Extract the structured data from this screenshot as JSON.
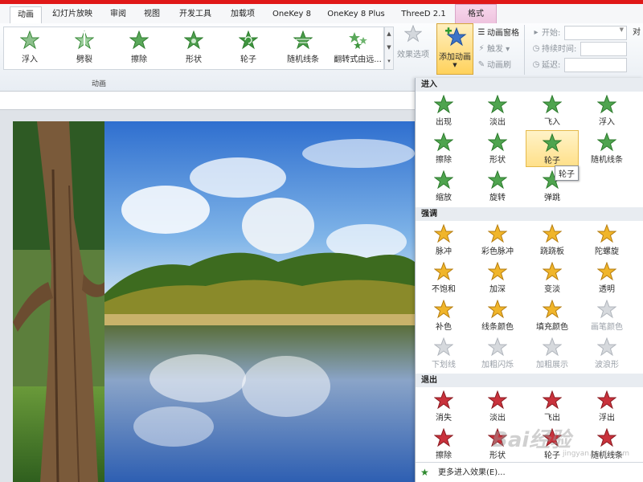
{
  "tabs": [
    "动画",
    "幻灯片放映",
    "审阅",
    "视图",
    "开发工具",
    "加载项",
    "OneKey 8",
    "OneKey 8 Plus",
    "ThreeD 2.1",
    "格式"
  ],
  "ribbon": {
    "gallery": [
      "浮入",
      "劈裂",
      "擦除",
      "形状",
      "轮子",
      "随机线条",
      "翻转式由远..."
    ],
    "group_label": "动画",
    "effect_options": "效果选项",
    "add_animation": "添加动画",
    "animation_pane": "动画窗格",
    "trigger": "触发",
    "animation_painter": "动画刷",
    "start_label": "开始:",
    "duration_label": "持续时间:",
    "delay_label": "延迟:",
    "reorder_partial": "对"
  },
  "dropdown": {
    "enter_title": "进入",
    "enter": [
      "出现",
      "淡出",
      "飞入",
      "浮入",
      "擦除",
      "形状",
      "轮子",
      "随机线条",
      "缩放",
      "旋转",
      "弹跳"
    ],
    "emphasis_title": "强调",
    "emphasis": [
      "脉冲",
      "彩色脉冲",
      "跷跷板",
      "陀螺旋",
      "不饱和",
      "加深",
      "变淡",
      "透明",
      "补色",
      "线条颜色",
      "填充颜色",
      "画笔颜色",
      "下划线",
      "加粗闪烁",
      "加粗展示",
      "波浪形"
    ],
    "exit_title": "退出",
    "exit": [
      "消失",
      "淡出",
      "飞出",
      "浮出",
      "擦除",
      "形状",
      "轮子",
      "随机线条"
    ],
    "tooltip": "轮子",
    "more": "更多进入效果(E)..."
  },
  "colors": {
    "green": "#3a9a3a",
    "gold": "#e4a317",
    "red": "#b8202a",
    "gray": "#b7bcc2",
    "accent": "#e01818"
  },
  "watermark": "Bai经验",
  "watermark_url": "jingyan.baidu.com"
}
